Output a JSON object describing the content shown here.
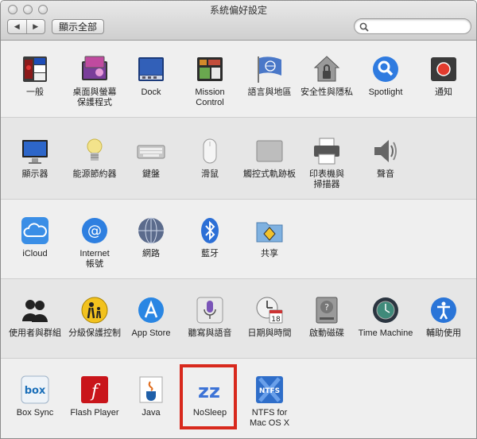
{
  "window": {
    "title": "系統偏好設定"
  },
  "toolbar": {
    "back_icon": "◀",
    "forward_icon": "▶",
    "show_all_label": "顯示全部",
    "search_placeholder": ""
  },
  "sections": [
    {
      "items": [
        {
          "label": "一般",
          "icon": "general-icon"
        },
        {
          "label": "桌面與螢幕\n保護程式",
          "icon": "desktop-screensaver-icon"
        },
        {
          "label": "Dock",
          "icon": "dock-icon"
        },
        {
          "label": "Mission\nControl",
          "icon": "mission-control-icon"
        },
        {
          "label": "語言與地區",
          "icon": "language-region-icon"
        },
        {
          "label": "安全性與隱私",
          "icon": "security-privacy-icon"
        },
        {
          "label": "Spotlight",
          "icon": "spotlight-icon"
        },
        {
          "label": "通知",
          "icon": "notifications-icon"
        }
      ]
    },
    {
      "items": [
        {
          "label": "顯示器",
          "icon": "displays-icon"
        },
        {
          "label": "能源節約器",
          "icon": "energy-saver-icon"
        },
        {
          "label": "鍵盤",
          "icon": "keyboard-icon"
        },
        {
          "label": "滑鼠",
          "icon": "mouse-icon"
        },
        {
          "label": "觸控式軌跡板",
          "icon": "trackpad-icon"
        },
        {
          "label": "印表機與\n掃描器",
          "icon": "printers-scanners-icon"
        },
        {
          "label": "聲音",
          "icon": "sound-icon"
        }
      ]
    },
    {
      "items": [
        {
          "label": "iCloud",
          "icon": "icloud-icon"
        },
        {
          "label": "Internet\n帳號",
          "icon": "internet-accounts-icon"
        },
        {
          "label": "網路",
          "icon": "network-icon"
        },
        {
          "label": "藍牙",
          "icon": "bluetooth-icon"
        },
        {
          "label": "共享",
          "icon": "sharing-icon"
        }
      ]
    },
    {
      "items": [
        {
          "label": "使用者與群組",
          "icon": "users-groups-icon"
        },
        {
          "label": "分級保護控制",
          "icon": "parental-controls-icon"
        },
        {
          "label": "App Store",
          "icon": "app-store-icon"
        },
        {
          "label": "聽寫與語音",
          "icon": "dictation-speech-icon"
        },
        {
          "label": "日期與時間",
          "icon": "date-time-icon",
          "day": "18"
        },
        {
          "label": "啟動磁碟",
          "icon": "startup-disk-icon"
        },
        {
          "label": "Time Machine",
          "icon": "time-machine-icon"
        },
        {
          "label": "輔助使用",
          "icon": "accessibility-icon"
        }
      ]
    },
    {
      "items": [
        {
          "label": "Box Sync",
          "icon": "box-sync-icon",
          "badge": "box"
        },
        {
          "label": "Flash Player",
          "icon": "flash-player-icon",
          "badge": "f"
        },
        {
          "label": "Java",
          "icon": "java-icon"
        },
        {
          "label": "NoSleep",
          "icon": "nosleep-icon",
          "badge": "zz"
        },
        {
          "label": "NTFS for\nMac OS X",
          "icon": "ntfs-icon",
          "badge": "NTFS"
        }
      ]
    }
  ],
  "colors": {
    "highlight": "#d8291d",
    "accent_blue": "#2a6fd6"
  }
}
